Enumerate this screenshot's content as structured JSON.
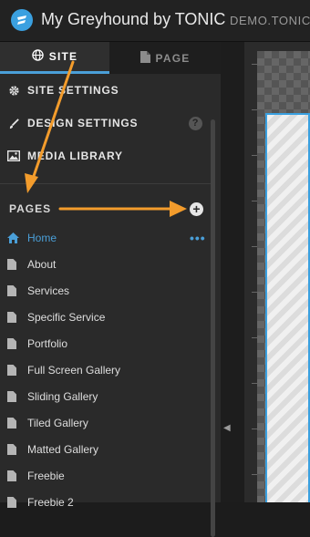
{
  "app": {
    "title": "My Greyhound by TONIC",
    "site_url": "DEMO.TONIC"
  },
  "tabs": [
    {
      "label": "SITE",
      "icon": "globe-icon",
      "active": true
    },
    {
      "label": "PAGE",
      "icon": "document-icon",
      "active": false
    }
  ],
  "menu": [
    {
      "label": "SITE SETTINGS",
      "icon": "gear-icon"
    },
    {
      "label": "DESIGN SETTINGS",
      "icon": "brush-icon",
      "help": "?"
    },
    {
      "label": "MEDIA LIBRARY",
      "icon": "image-icon"
    }
  ],
  "pages": {
    "header": "PAGES",
    "add_label": "+",
    "items": [
      {
        "label": "Home",
        "icon": "home-icon",
        "active": true,
        "more": "•••"
      },
      {
        "label": "About",
        "icon": "page-icon"
      },
      {
        "label": "Services",
        "icon": "page-icon"
      },
      {
        "label": "Specific Service",
        "icon": "page-icon"
      },
      {
        "label": "Portfolio",
        "icon": "page-icon"
      },
      {
        "label": "Full Screen Gallery",
        "icon": "page-icon"
      },
      {
        "label": "Sliding Gallery",
        "icon": "page-icon"
      },
      {
        "label": "Tiled Gallery",
        "icon": "page-icon"
      },
      {
        "label": "Matted Gallery",
        "icon": "page-icon"
      },
      {
        "label": "Freebie",
        "icon": "page-icon"
      },
      {
        "label": "Freebie 2",
        "icon": "page-icon"
      }
    ]
  },
  "colors": {
    "accent": "#4a9fd8",
    "annotation_arrow": "#f39c2c"
  }
}
